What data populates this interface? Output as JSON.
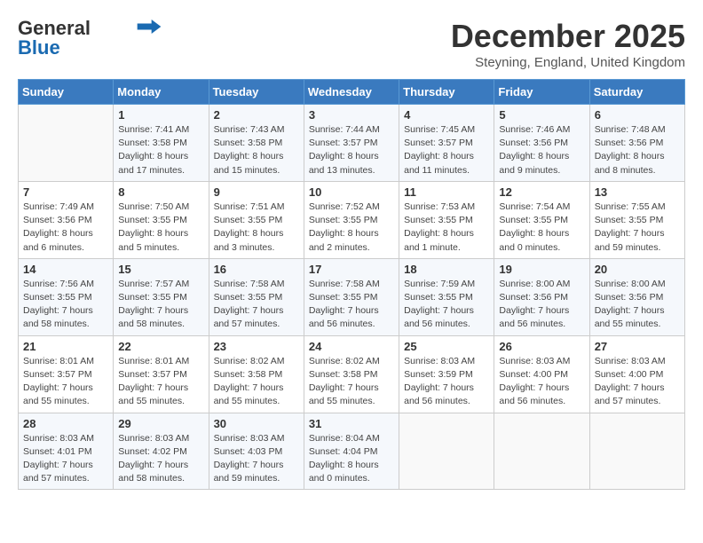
{
  "logo": {
    "general": "General",
    "blue": "Blue"
  },
  "header": {
    "month": "December 2025",
    "location": "Steyning, England, United Kingdom"
  },
  "weekdays": [
    "Sunday",
    "Monday",
    "Tuesday",
    "Wednesday",
    "Thursday",
    "Friday",
    "Saturday"
  ],
  "weeks": [
    [
      {
        "day": "",
        "info": ""
      },
      {
        "day": "1",
        "info": "Sunrise: 7:41 AM\nSunset: 3:58 PM\nDaylight: 8 hours\nand 17 minutes."
      },
      {
        "day": "2",
        "info": "Sunrise: 7:43 AM\nSunset: 3:58 PM\nDaylight: 8 hours\nand 15 minutes."
      },
      {
        "day": "3",
        "info": "Sunrise: 7:44 AM\nSunset: 3:57 PM\nDaylight: 8 hours\nand 13 minutes."
      },
      {
        "day": "4",
        "info": "Sunrise: 7:45 AM\nSunset: 3:57 PM\nDaylight: 8 hours\nand 11 minutes."
      },
      {
        "day": "5",
        "info": "Sunrise: 7:46 AM\nSunset: 3:56 PM\nDaylight: 8 hours\nand 9 minutes."
      },
      {
        "day": "6",
        "info": "Sunrise: 7:48 AM\nSunset: 3:56 PM\nDaylight: 8 hours\nand 8 minutes."
      }
    ],
    [
      {
        "day": "7",
        "info": "Sunrise: 7:49 AM\nSunset: 3:56 PM\nDaylight: 8 hours\nand 6 minutes."
      },
      {
        "day": "8",
        "info": "Sunrise: 7:50 AM\nSunset: 3:55 PM\nDaylight: 8 hours\nand 5 minutes."
      },
      {
        "day": "9",
        "info": "Sunrise: 7:51 AM\nSunset: 3:55 PM\nDaylight: 8 hours\nand 3 minutes."
      },
      {
        "day": "10",
        "info": "Sunrise: 7:52 AM\nSunset: 3:55 PM\nDaylight: 8 hours\nand 2 minutes."
      },
      {
        "day": "11",
        "info": "Sunrise: 7:53 AM\nSunset: 3:55 PM\nDaylight: 8 hours\nand 1 minute."
      },
      {
        "day": "12",
        "info": "Sunrise: 7:54 AM\nSunset: 3:55 PM\nDaylight: 8 hours\nand 0 minutes."
      },
      {
        "day": "13",
        "info": "Sunrise: 7:55 AM\nSunset: 3:55 PM\nDaylight: 7 hours\nand 59 minutes."
      }
    ],
    [
      {
        "day": "14",
        "info": "Sunrise: 7:56 AM\nSunset: 3:55 PM\nDaylight: 7 hours\nand 58 minutes."
      },
      {
        "day": "15",
        "info": "Sunrise: 7:57 AM\nSunset: 3:55 PM\nDaylight: 7 hours\nand 58 minutes."
      },
      {
        "day": "16",
        "info": "Sunrise: 7:58 AM\nSunset: 3:55 PM\nDaylight: 7 hours\nand 57 minutes."
      },
      {
        "day": "17",
        "info": "Sunrise: 7:58 AM\nSunset: 3:55 PM\nDaylight: 7 hours\nand 56 minutes."
      },
      {
        "day": "18",
        "info": "Sunrise: 7:59 AM\nSunset: 3:55 PM\nDaylight: 7 hours\nand 56 minutes."
      },
      {
        "day": "19",
        "info": "Sunrise: 8:00 AM\nSunset: 3:56 PM\nDaylight: 7 hours\nand 56 minutes."
      },
      {
        "day": "20",
        "info": "Sunrise: 8:00 AM\nSunset: 3:56 PM\nDaylight: 7 hours\nand 55 minutes."
      }
    ],
    [
      {
        "day": "21",
        "info": "Sunrise: 8:01 AM\nSunset: 3:57 PM\nDaylight: 7 hours\nand 55 minutes."
      },
      {
        "day": "22",
        "info": "Sunrise: 8:01 AM\nSunset: 3:57 PM\nDaylight: 7 hours\nand 55 minutes."
      },
      {
        "day": "23",
        "info": "Sunrise: 8:02 AM\nSunset: 3:58 PM\nDaylight: 7 hours\nand 55 minutes."
      },
      {
        "day": "24",
        "info": "Sunrise: 8:02 AM\nSunset: 3:58 PM\nDaylight: 7 hours\nand 55 minutes."
      },
      {
        "day": "25",
        "info": "Sunrise: 8:03 AM\nSunset: 3:59 PM\nDaylight: 7 hours\nand 56 minutes."
      },
      {
        "day": "26",
        "info": "Sunrise: 8:03 AM\nSunset: 4:00 PM\nDaylight: 7 hours\nand 56 minutes."
      },
      {
        "day": "27",
        "info": "Sunrise: 8:03 AM\nSunset: 4:00 PM\nDaylight: 7 hours\nand 57 minutes."
      }
    ],
    [
      {
        "day": "28",
        "info": "Sunrise: 8:03 AM\nSunset: 4:01 PM\nDaylight: 7 hours\nand 57 minutes."
      },
      {
        "day": "29",
        "info": "Sunrise: 8:03 AM\nSunset: 4:02 PM\nDaylight: 7 hours\nand 58 minutes."
      },
      {
        "day": "30",
        "info": "Sunrise: 8:03 AM\nSunset: 4:03 PM\nDaylight: 7 hours\nand 59 minutes."
      },
      {
        "day": "31",
        "info": "Sunrise: 8:04 AM\nSunset: 4:04 PM\nDaylight: 8 hours\nand 0 minutes."
      },
      {
        "day": "",
        "info": ""
      },
      {
        "day": "",
        "info": ""
      },
      {
        "day": "",
        "info": ""
      }
    ]
  ]
}
